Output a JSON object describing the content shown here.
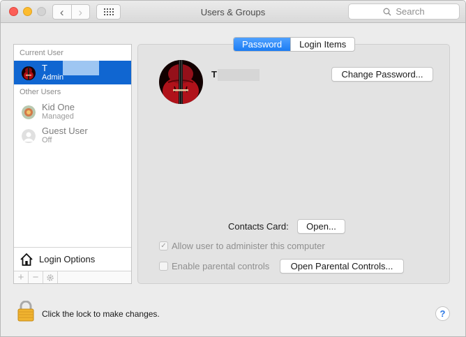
{
  "window": {
    "title": "Users & Groups",
    "search_placeholder": "Search",
    "back_glyph": "‹",
    "forward_glyph": "›"
  },
  "sidebar": {
    "current_user_header": "Current User",
    "current_user": {
      "name": "T",
      "role": "Admin"
    },
    "other_users_header": "Other Users",
    "other_users": [
      {
        "name": "Kid One",
        "role": "Managed",
        "icon": "kid-avatar-icon"
      },
      {
        "name": "Guest User",
        "role": "Off",
        "icon": "guest-avatar-icon"
      }
    ],
    "login_options_label": "Login Options",
    "toolbar": {
      "add": "+",
      "remove": "−"
    }
  },
  "panel": {
    "tabs": [
      {
        "label": "Password",
        "active": true
      },
      {
        "label": "Login Items",
        "active": false
      }
    ],
    "user_name": "T",
    "change_password_button": "Change Password...",
    "contacts_card_label": "Contacts Card:",
    "open_button": "Open...",
    "allow_admin_label": "Allow user to administer this computer",
    "allow_admin_checked": true,
    "parental_controls_label": "Enable parental controls",
    "parental_controls_checked": false,
    "open_parental_controls_button": "Open Parental Controls..."
  },
  "footer": {
    "lock_text": "Click the lock to make changes.",
    "help_label": "?"
  },
  "colors": {
    "selection": "#1066d1",
    "tab_active": "#1b7cf3",
    "close": "#fc5f57",
    "minimize": "#fdbc2e"
  }
}
